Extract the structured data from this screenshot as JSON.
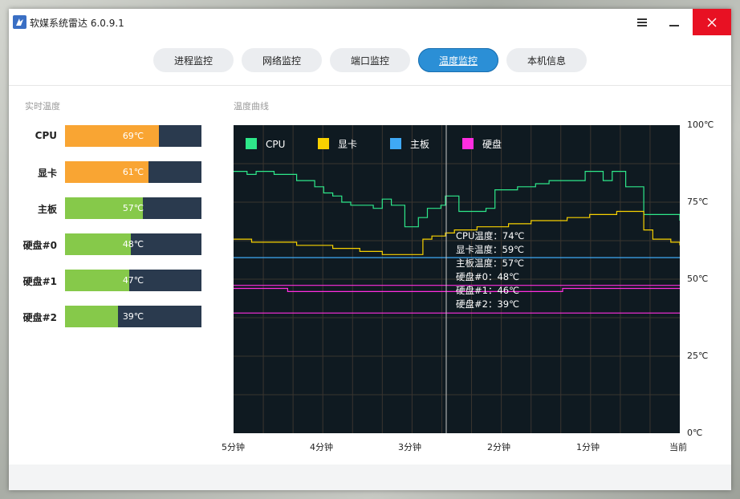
{
  "window": {
    "title": "软媒系统雷达 6.0.9.1",
    "icons": {
      "app": "radar-app-icon",
      "menu": "hamburger-menu-icon",
      "minimize": "minimize-icon",
      "close": "close-icon"
    }
  },
  "tabs": [
    {
      "label": "进程监控",
      "active": false
    },
    {
      "label": "网络监控",
      "active": false
    },
    {
      "label": "端口监控",
      "active": false
    },
    {
      "label": "温度监控",
      "active": true
    },
    {
      "label": "本机信息",
      "active": false
    }
  ],
  "realtime": {
    "title": "实时温度",
    "items": [
      {
        "label": "CPU",
        "value_text": "69℃",
        "value": 69,
        "color": "#f9a533"
      },
      {
        "label": "显卡",
        "value_text": "61℃",
        "value": 61,
        "color": "#f9a533"
      },
      {
        "label": "主板",
        "value_text": "57℃",
        "value": 57,
        "color": "#86c94a"
      },
      {
        "label": "硬盘#0",
        "value_text": "48℃",
        "value": 48,
        "color": "#86c94a"
      },
      {
        "label": "硬盘#1",
        "value_text": "47℃",
        "value": 47,
        "color": "#86c94a"
      },
      {
        "label": "硬盘#2",
        "value_text": "39℃",
        "value": 39,
        "color": "#86c94a"
      }
    ]
  },
  "curve": {
    "title": "温度曲线",
    "tooltip": [
      "CPU温度：74℃",
      "显卡温度：59℃",
      "主板温度：57℃",
      "硬盘#0：48℃",
      "硬盘#1：46℃",
      "硬盘#2：39℃"
    ]
  },
  "chart_data": {
    "type": "line",
    "ylim": [
      0,
      100
    ],
    "y_ticks": [
      "100℃",
      "75℃",
      "50℃",
      "25℃",
      "0℃"
    ],
    "x_ticks": [
      "5分钟",
      "4分钟",
      "3分钟",
      "2分钟",
      "1分钟",
      "当前"
    ],
    "legend_position": "top-left",
    "grid": true,
    "series": [
      {
        "name": "CPU",
        "color": "#2ee88a",
        "values": [
          85,
          85,
          85,
          84,
          84,
          85,
          85,
          85,
          85,
          84,
          84,
          84,
          84,
          84,
          82,
          82,
          82,
          82,
          80,
          80,
          78,
          78,
          77,
          77,
          75,
          75,
          74,
          74,
          74,
          74,
          74,
          73,
          73,
          76,
          76,
          74,
          74,
          74,
          67,
          67,
          67,
          70,
          70,
          73,
          73,
          73,
          74,
          77,
          77,
          77,
          72,
          72,
          72,
          72,
          72,
          72,
          73,
          73,
          79,
          79,
          79,
          79,
          79,
          80,
          80,
          80,
          80,
          81,
          81,
          81,
          82,
          82,
          82,
          82,
          82,
          82,
          82,
          82,
          85,
          85,
          85,
          85,
          82,
          82,
          85,
          85,
          85,
          80,
          80,
          80,
          80,
          71,
          71,
          71,
          71,
          71,
          71,
          71,
          71,
          69
        ]
      },
      {
        "name": "显卡",
        "color": "#f7d100",
        "values": [
          63,
          63,
          63,
          63,
          62,
          62,
          62,
          62,
          62,
          62,
          62,
          62,
          62,
          62,
          61,
          61,
          61,
          61,
          61,
          61,
          61,
          61,
          60,
          60,
          60,
          60,
          60,
          60,
          59,
          59,
          59,
          59,
          59,
          58,
          58,
          58,
          58,
          58,
          58,
          58,
          58,
          58,
          63,
          63,
          64,
          64,
          64,
          65,
          65,
          66,
          66,
          66,
          66,
          66,
          67,
          67,
          67,
          67,
          67,
          67,
          67,
          68,
          68,
          68,
          68,
          68,
          69,
          69,
          69,
          69,
          69,
          69,
          69,
          69,
          70,
          70,
          70,
          70,
          70,
          71,
          71,
          71,
          71,
          71,
          71,
          72,
          72,
          72,
          72,
          72,
          72,
          66,
          66,
          63,
          63,
          63,
          63,
          62,
          62,
          61
        ]
      },
      {
        "name": "主板",
        "color": "#3fa9f5",
        "values": [
          57,
          57,
          57,
          57,
          57,
          57,
          57,
          57,
          57,
          57,
          57,
          57,
          57,
          57,
          57,
          57,
          57,
          57,
          57,
          57,
          57,
          57,
          57,
          57,
          57,
          57,
          57,
          57,
          57,
          57,
          57,
          57,
          57,
          57,
          57,
          57,
          57,
          57,
          57,
          57,
          57,
          57,
          57,
          57,
          57,
          57,
          57,
          57,
          57,
          57,
          57,
          57,
          57,
          57,
          57,
          57,
          57,
          57,
          57,
          57,
          57,
          57,
          57,
          57,
          57,
          57,
          57,
          57,
          57,
          57,
          57,
          57,
          57,
          57,
          57,
          57,
          57,
          57,
          57,
          57,
          57,
          57,
          57,
          57,
          57,
          57,
          57,
          57,
          57,
          57,
          57,
          57,
          57,
          57,
          57,
          57,
          57,
          57,
          57,
          57
        ]
      },
      {
        "name": "硬盘",
        "color": "#ff2ee0",
        "values": [
          48,
          48,
          48,
          48,
          48,
          48,
          48,
          48,
          48,
          48,
          48,
          48,
          48,
          48,
          48,
          48,
          48,
          48,
          48,
          48,
          48,
          48,
          48,
          48,
          48,
          48,
          48,
          48,
          48,
          48,
          48,
          48,
          48,
          48,
          48,
          48,
          48,
          48,
          48,
          48,
          48,
          48,
          48,
          48,
          48,
          48,
          48,
          48,
          48,
          48,
          48,
          48,
          48,
          48,
          48,
          48,
          48,
          48,
          48,
          48,
          48,
          48,
          48,
          48,
          48,
          48,
          48,
          48,
          48,
          48,
          48,
          48,
          48,
          48,
          48,
          48,
          48,
          48,
          48,
          48,
          48,
          48,
          48,
          48,
          48,
          48,
          48,
          48,
          48,
          48,
          48,
          48,
          48,
          48,
          48,
          48,
          48,
          48,
          48,
          48
        ]
      },
      {
        "color": "#ff2ee0",
        "values": [
          47,
          47,
          47,
          47,
          47,
          47,
          47,
          47,
          47,
          47,
          47,
          47,
          46,
          46,
          46,
          46,
          46,
          46,
          46,
          46,
          46,
          46,
          46,
          46,
          46,
          46,
          46,
          46,
          46,
          46,
          46,
          46,
          46,
          46,
          46,
          46,
          46,
          46,
          46,
          46,
          46,
          46,
          46,
          46,
          46,
          46,
          46,
          46,
          46,
          46,
          46,
          46,
          46,
          46,
          46,
          46,
          46,
          46,
          46,
          46,
          46,
          46,
          46,
          46,
          46,
          46,
          46,
          46,
          46,
          46,
          46,
          46,
          46,
          47,
          47,
          47,
          47,
          47,
          47,
          47,
          47,
          47,
          47,
          47,
          47,
          47,
          47,
          47,
          47,
          47,
          47,
          47,
          47,
          47,
          47,
          47,
          47,
          47,
          47,
          47
        ]
      },
      {
        "color": "#ff2ee0",
        "values": [
          39,
          39,
          39,
          39,
          39,
          39,
          39,
          39,
          39,
          39,
          39,
          39,
          39,
          39,
          39,
          39,
          39,
          39,
          39,
          39,
          39,
          39,
          39,
          39,
          39,
          39,
          39,
          39,
          39,
          39,
          39,
          39,
          39,
          39,
          39,
          39,
          39,
          39,
          39,
          39,
          39,
          39,
          39,
          39,
          39,
          39,
          39,
          39,
          39,
          39,
          39,
          39,
          39,
          39,
          39,
          39,
          39,
          39,
          39,
          39,
          39,
          39,
          39,
          39,
          39,
          39,
          39,
          39,
          39,
          39,
          39,
          39,
          39,
          39,
          39,
          39,
          39,
          39,
          39,
          39,
          39,
          39,
          39,
          39,
          39,
          39,
          39,
          39,
          39,
          39,
          39,
          39,
          39,
          39,
          39,
          39,
          39,
          39,
          39,
          39
        ]
      }
    ]
  }
}
